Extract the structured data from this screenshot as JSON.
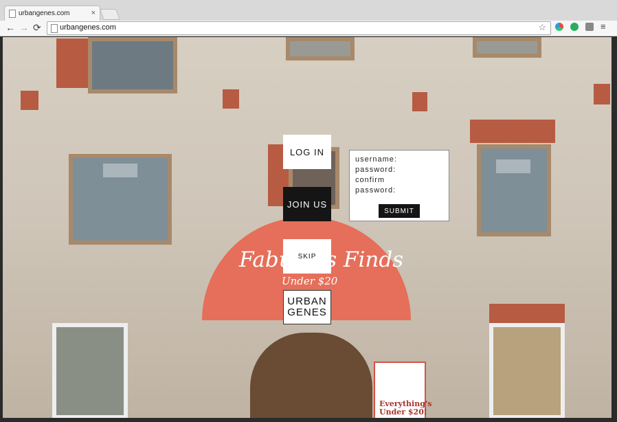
{
  "browser": {
    "tab_title": "urbangenes.com",
    "tab_close": "×",
    "url": "urbangenes.com",
    "nav_back": "←",
    "nav_forward": "→",
    "nav_reload": "⟳",
    "bookmark_star": "☆",
    "menu_icon": "≡"
  },
  "nav": {
    "login_label": "LOG IN",
    "join_label": "JOIN US",
    "skip_label": "SKIP"
  },
  "logo": {
    "line1": "URBAN",
    "line2": "GENES"
  },
  "form": {
    "username_label": "username:",
    "password_label": "password:",
    "confirm_label_1": "confirm",
    "confirm_label_2": "password:",
    "submit_label": "SUBMIT"
  },
  "storefront": {
    "awning_text": "Fabulous Finds",
    "awning_sub": "Under $20",
    "sign_line1": "Everything's",
    "sign_line2": "Under $20!"
  }
}
